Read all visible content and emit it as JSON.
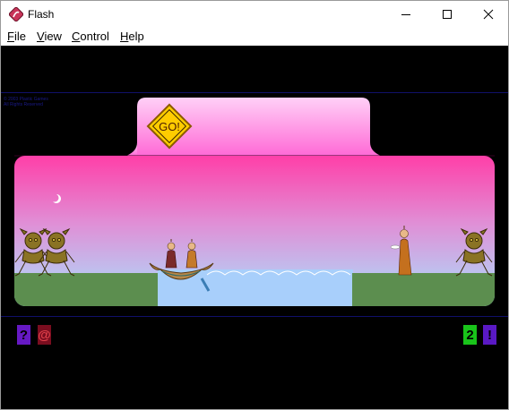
{
  "window": {
    "title": "Flash",
    "minimize_icon": "minimize-icon",
    "maximize_icon": "maximize-icon",
    "close_icon": "close-icon"
  },
  "menu": {
    "items": [
      "File",
      "View",
      "Control",
      "Help"
    ]
  },
  "game": {
    "go_label": "GO!",
    "copyright_line1": "© 2003 Plastic Games",
    "copyright_line2": "All Rights Reserved",
    "help_label": "?",
    "email_label": "@",
    "count_label": "2",
    "info_label": "!",
    "colors": {
      "help_button": "#6619c4",
      "email_button": "#7a0d1f",
      "count_button": "#19c41a",
      "info_button": "#5a19c4",
      "panel_pink": "#ff88e6",
      "sky_top": "#ff3fa8",
      "sky_bottom": "#a8e2ff",
      "grass": "#5c8e4f",
      "water": "#a8cffb"
    }
  }
}
